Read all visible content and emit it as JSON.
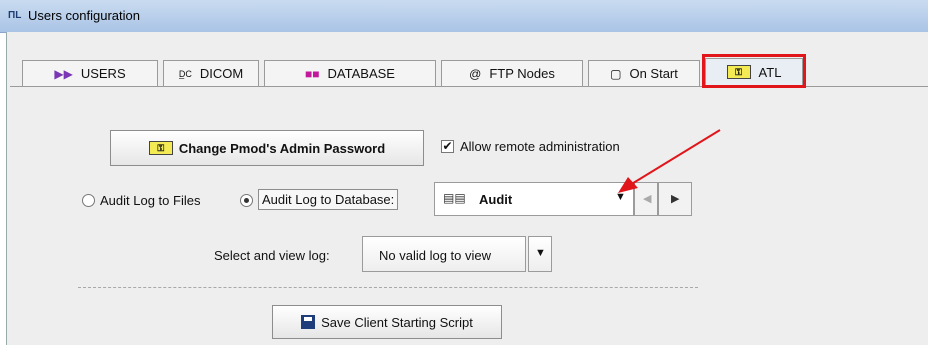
{
  "window": {
    "title": "Users configuration",
    "app_icon_text": "ΠL"
  },
  "tabs": [
    {
      "label": "USERS",
      "icon": "users-icon"
    },
    {
      "label": "DICOM",
      "icon": "dicom-icon"
    },
    {
      "label": "DATABASE",
      "icon": "database-icon"
    },
    {
      "label": "FTP Nodes",
      "icon": "at-sign-icon"
    },
    {
      "label": "On Start",
      "icon": "start-icon"
    },
    {
      "label": "ATL",
      "icon": "key-icon",
      "active": true
    }
  ],
  "atl": {
    "change_password_label": "Change Pmod's Admin Password",
    "allow_remote_label": "Allow remote administration",
    "allow_remote_checked": true,
    "audit_files_label": "Audit Log to Files",
    "audit_db_label": "Audit Log to Database:",
    "audit_db_selected": true,
    "audit_db_value": "Audit",
    "select_log_label": "Select and view log:",
    "log_value": "No valid log to view",
    "save_script_label": "Save Client Starting Script"
  },
  "colors": {
    "highlight": "#e0161b",
    "arrow": "#e0161b",
    "key_yellow": "#f3ea54"
  }
}
